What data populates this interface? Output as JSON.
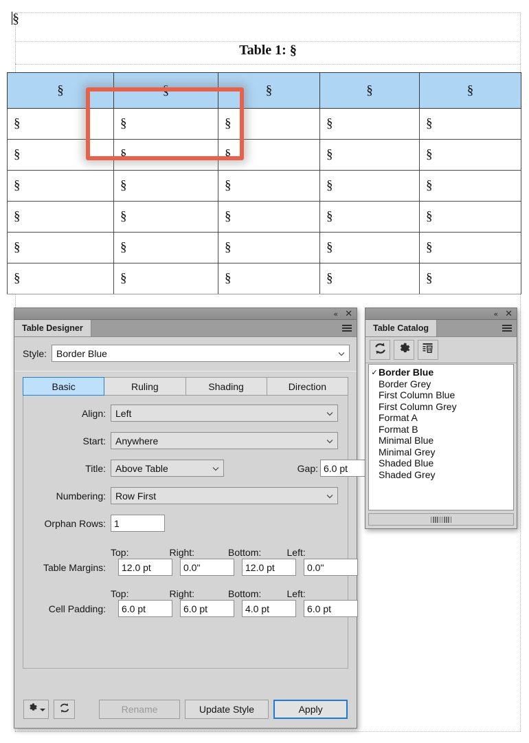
{
  "document": {
    "first_paragraph_mark": "§",
    "table_caption": "Table 1: §",
    "table": {
      "header_cells": [
        "§",
        "§",
        "§",
        "§",
        "§"
      ],
      "body_rows": [
        [
          "§",
          "§",
          "§",
          "§",
          "§"
        ],
        [
          "§",
          "§",
          "§",
          "§",
          "§"
        ],
        [
          "§",
          "§",
          "§",
          "§",
          "§"
        ],
        [
          "§",
          "§",
          "§",
          "§",
          "§"
        ],
        [
          "§",
          "§",
          "§",
          "§",
          "§"
        ],
        [
          "§",
          "§",
          "§",
          "§",
          "§"
        ]
      ],
      "header_fill": "#aed5f4"
    },
    "annotation": {
      "color": "#e8614a"
    }
  },
  "designer": {
    "tab_title": "Table Designer",
    "collapse_label": "«",
    "close_label": "✕",
    "style_label": "Style:",
    "style_value": "Border Blue",
    "tabs": [
      {
        "label": "Basic",
        "active": true
      },
      {
        "label": "Ruling",
        "active": false
      },
      {
        "label": "Shading",
        "active": false
      },
      {
        "label": "Direction",
        "active": false
      }
    ],
    "fields": {
      "align_label": "Align:",
      "align_value": "Left",
      "start_label": "Start:",
      "start_value": "Anywhere",
      "title_label": "Title:",
      "title_value": "Above Table",
      "gap_label": "Gap:",
      "gap_value": "6.0 pt",
      "numbering_label": "Numbering:",
      "numbering_value": "Row First",
      "orphan_label": "Orphan Rows:",
      "orphan_value": "1"
    },
    "margins": {
      "row_label": "Table Margins:",
      "head_top": "Top:",
      "head_right": "Right:",
      "head_bottom": "Bottom:",
      "head_left": "Left:",
      "top": "12.0 pt",
      "right": "0.0\"",
      "bottom": "12.0 pt",
      "left": "0.0\""
    },
    "padding": {
      "row_label": "Cell Padding:",
      "head_top": "Top:",
      "head_right": "Right:",
      "head_bottom": "Bottom:",
      "head_left": "Left:",
      "top": "6.0 pt",
      "right": "6.0 pt",
      "bottom": "4.0 pt",
      "left": "6.0 pt"
    },
    "buttons": {
      "rename": "Rename",
      "update_style": "Update Style",
      "apply": "Apply"
    },
    "accent_color": "#1f7ad6"
  },
  "catalog": {
    "tab_title": "Table Catalog",
    "collapse_label": "«",
    "close_label": "✕",
    "items": [
      {
        "label": "Border Blue",
        "selected": true,
        "check": "✓"
      },
      {
        "label": "Border Grey",
        "selected": false,
        "check": ""
      },
      {
        "label": "First Column Blue",
        "selected": false,
        "check": ""
      },
      {
        "label": "First Column Grey",
        "selected": false,
        "check": ""
      },
      {
        "label": "Format A",
        "selected": false,
        "check": ""
      },
      {
        "label": "Format B",
        "selected": false,
        "check": ""
      },
      {
        "label": "Minimal Blue",
        "selected": false,
        "check": ""
      },
      {
        "label": "Minimal Grey",
        "selected": false,
        "check": ""
      },
      {
        "label": "Shaded Blue",
        "selected": false,
        "check": ""
      },
      {
        "label": "Shaded Grey",
        "selected": false,
        "check": ""
      }
    ]
  }
}
